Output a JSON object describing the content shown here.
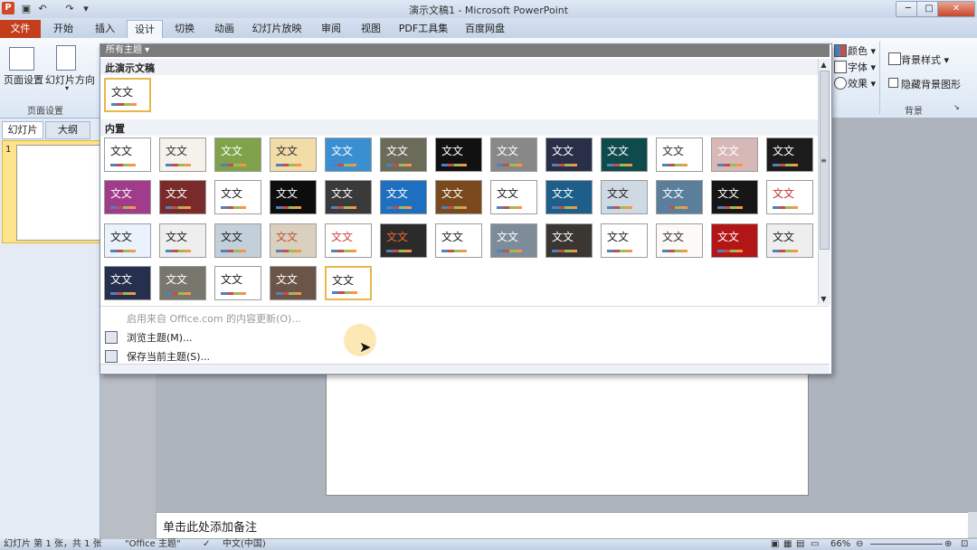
{
  "window": {
    "title": "演示文稿1 - Microsoft PowerPoint",
    "app_icon": "P",
    "controls": [
      "─",
      "□",
      "✕"
    ]
  },
  "tabs": [
    {
      "label": "文件"
    },
    {
      "label": "开始"
    },
    {
      "label": "插入"
    },
    {
      "label": "设计"
    },
    {
      "label": "切换"
    },
    {
      "label": "动画"
    },
    {
      "label": "幻灯片放映"
    },
    {
      "label": "审阅"
    },
    {
      "label": "视图"
    },
    {
      "label": "PDF工具集"
    },
    {
      "label": "百度网盘"
    }
  ],
  "ribbon": {
    "page_setup": "页面设置",
    "orientation": "幻灯片方向",
    "group_page": "页面设置",
    "colors": "颜色",
    "fonts": "字体",
    "effects": "效果",
    "bg_styles": "背景样式",
    "hide_bg": "隐藏背景图形",
    "group_bg": "背景"
  },
  "left_panel": {
    "tab_slides": "幻灯片",
    "tab_outline": "大纲",
    "slide_number": "1"
  },
  "gallery": {
    "header": "所有主题 ▾",
    "section_this": "此演示文稿",
    "section_builtin": "内置",
    "thumb_text": "文文",
    "menu": {
      "update": "启用来自 Office.com 的内容更新(O)...",
      "browse": "浏览主题(M)...",
      "save": "保存当前主题(S)..."
    }
  },
  "notes": {
    "placeholder": "单击此处添加备注"
  },
  "status": {
    "slide_info": "幻灯片 第 1 张，共 1 张",
    "theme": "\"Office 主题\"",
    "lang": "中文(中国)",
    "zoom": "66%"
  },
  "colors": {
    "file_tab": "#c43e1c",
    "selected_border": "#e8b74a"
  }
}
